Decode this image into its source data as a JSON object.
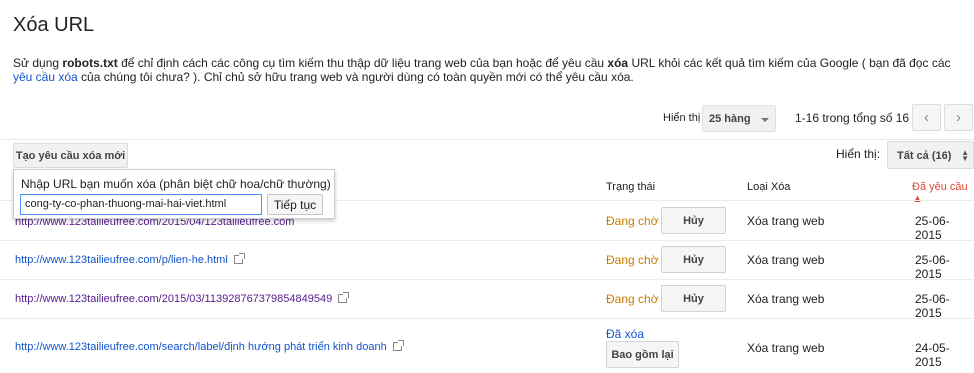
{
  "page": {
    "title": "Xóa URL",
    "description": {
      "t1": "Sử dụng ",
      "b1": "robots.txt",
      "t2": " để chỉ định cách các công cụ tìm kiếm thu thập dữ liệu trang web của bạn hoặc để yêu cầu ",
      "b2": "xóa",
      "t3": " URL khỏi các kết quả tìm kiếm của Google ( bạn đã đọc các ",
      "link": "yêu cầu xóa",
      "t4": " của chúng tôi chưa? ). Chỉ chủ sở hữu trang web và người dùng có toàn quyền mới có thể yêu cầu xóa."
    }
  },
  "pagination": {
    "show_label": "Hiển thị",
    "rows_value": "25 hàng",
    "range": "1-16 trong tổng số 16",
    "prev_icon": "‹",
    "next_icon": "›"
  },
  "toolbar": {
    "new_request": "Tạo yêu cầu xóa mới",
    "filter_label": "Hiển thị:",
    "filter_value": "Tất cả (16)"
  },
  "popup": {
    "label": "Nhập URL bạn muốn xóa (phân biệt chữ hoa/chữ thường)",
    "input_value": "cong-ty-co-phan-thuong-mai-hai-viet.html",
    "submit": "Tiếp tục"
  },
  "table": {
    "headers": {
      "status": "Trạng thái",
      "type": "Loại Xóa",
      "requested": "Đã yêu cầu ▲"
    },
    "rows": [
      {
        "url": "http://www.123tailieufree.com/2015/04/123tailieufree.com",
        "status": "Đang chờ",
        "action": "Hủy",
        "type": "Xóa trang web",
        "date": "25-06-2015"
      },
      {
        "url": "http://www.123tailieufree.com/p/lien-he.html",
        "status": "Đang chờ",
        "action": "Hủy",
        "type": "Xóa trang web",
        "date": "25-06-2015"
      },
      {
        "url": "http://www.123tailieufree.com/2015/03/113928767379854849549",
        "status": "Đang chờ",
        "action": "Hủy",
        "type": "Xóa trang web",
        "date": "25-06-2015"
      },
      {
        "url": "http://www.123tailieufree.com/search/label/định hướng phát triển kinh doanh",
        "status": "Đã xóa",
        "action": "Bao gồm lại",
        "type": "Xóa trang web",
        "date": "24-05-2015"
      }
    ]
  },
  "colors": {
    "link": "#1155cc",
    "visited_link": "#551a8b",
    "pending": "#c77e00",
    "sort_header": "#dd4b39"
  }
}
